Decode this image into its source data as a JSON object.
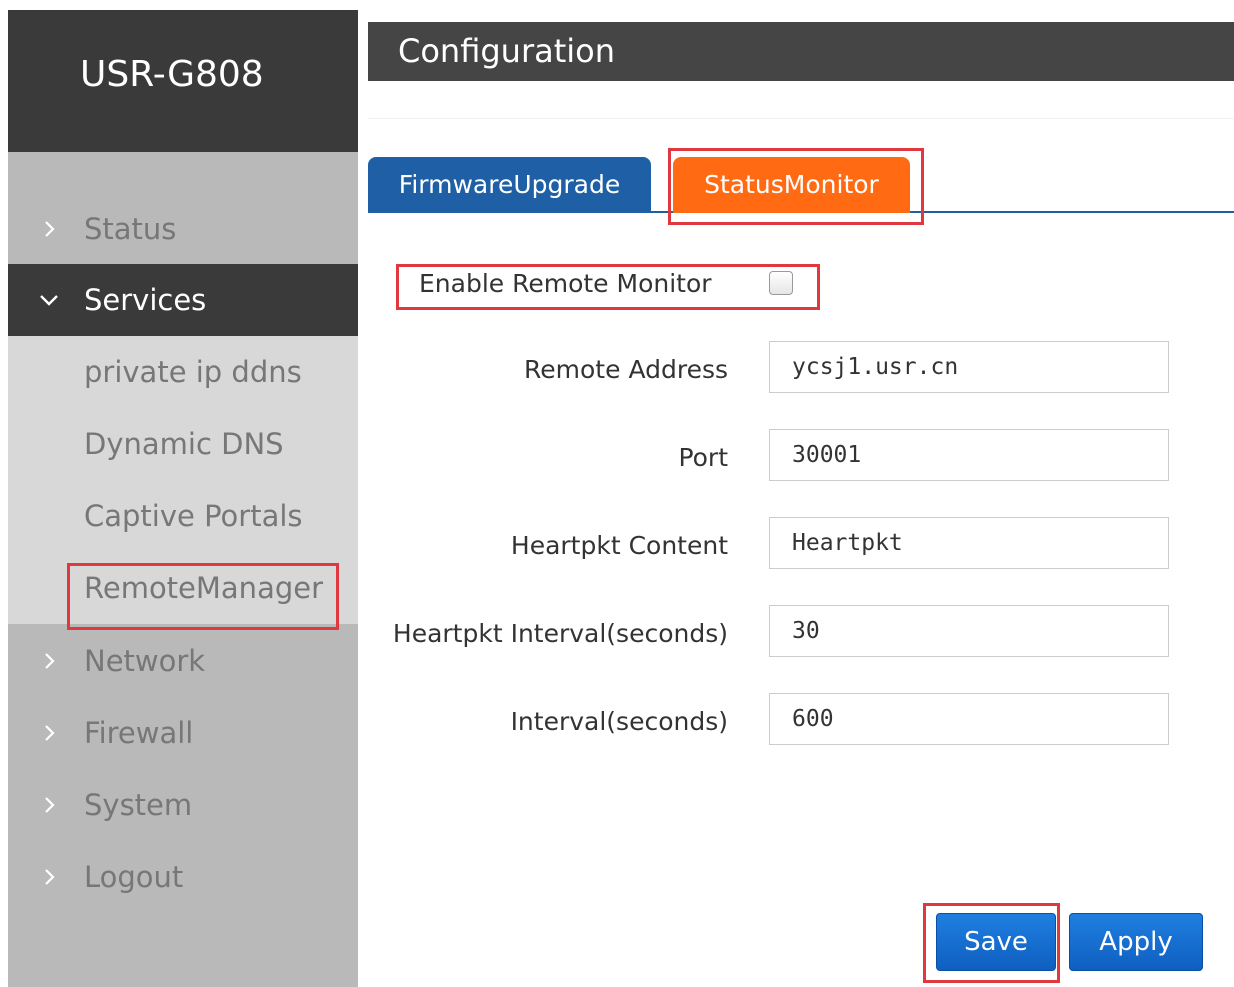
{
  "sidebar": {
    "brand": "USR-G808",
    "items": [
      {
        "label": "Status",
        "icon": "chevron-right-icon"
      },
      {
        "label": "Services",
        "icon": "chevron-down-icon"
      },
      {
        "label": "Network",
        "icon": "chevron-right-icon"
      },
      {
        "label": "Firewall",
        "icon": "chevron-right-icon"
      },
      {
        "label": "System",
        "icon": "chevron-right-icon"
      },
      {
        "label": "Logout",
        "icon": "chevron-right-icon"
      }
    ],
    "services_submenu": [
      {
        "label": "private ip ddns"
      },
      {
        "label": "Dynamic DNS"
      },
      {
        "label": "Captive Portals"
      },
      {
        "label": "RemoteManager"
      }
    ],
    "active_item": "Services",
    "active_sub_item": "RemoteManager"
  },
  "header": {
    "title": "Configuration"
  },
  "tabs": [
    {
      "label": "FirmwareUpgrade"
    },
    {
      "label": "StatusMonitor"
    }
  ],
  "active_tab": "StatusMonitor",
  "form": {
    "enable_label": "Enable Remote Monitor",
    "enable_checked": false,
    "fields": [
      {
        "label": "Remote Address",
        "value": "ycsj1.usr.cn"
      },
      {
        "label": "Port",
        "value": "30001"
      },
      {
        "label": "Heartpkt Content",
        "value": "Heartpkt"
      },
      {
        "label": "Heartpkt Interval(seconds)",
        "value": "30"
      },
      {
        "label": "Interval(seconds)",
        "value": "600"
      }
    ]
  },
  "buttons": {
    "save": "Save",
    "apply": "Apply"
  },
  "colors": {
    "sidebar_bg": "#b9b9b9",
    "sidebar_dark": "#3a3a3a",
    "submenu_bg": "#d8d8d8",
    "tab_blue": "#1f5fa5",
    "tab_orange": "#ff6a12",
    "highlight_red": "#e0383f",
    "button_blue": "#1a72d6"
  }
}
